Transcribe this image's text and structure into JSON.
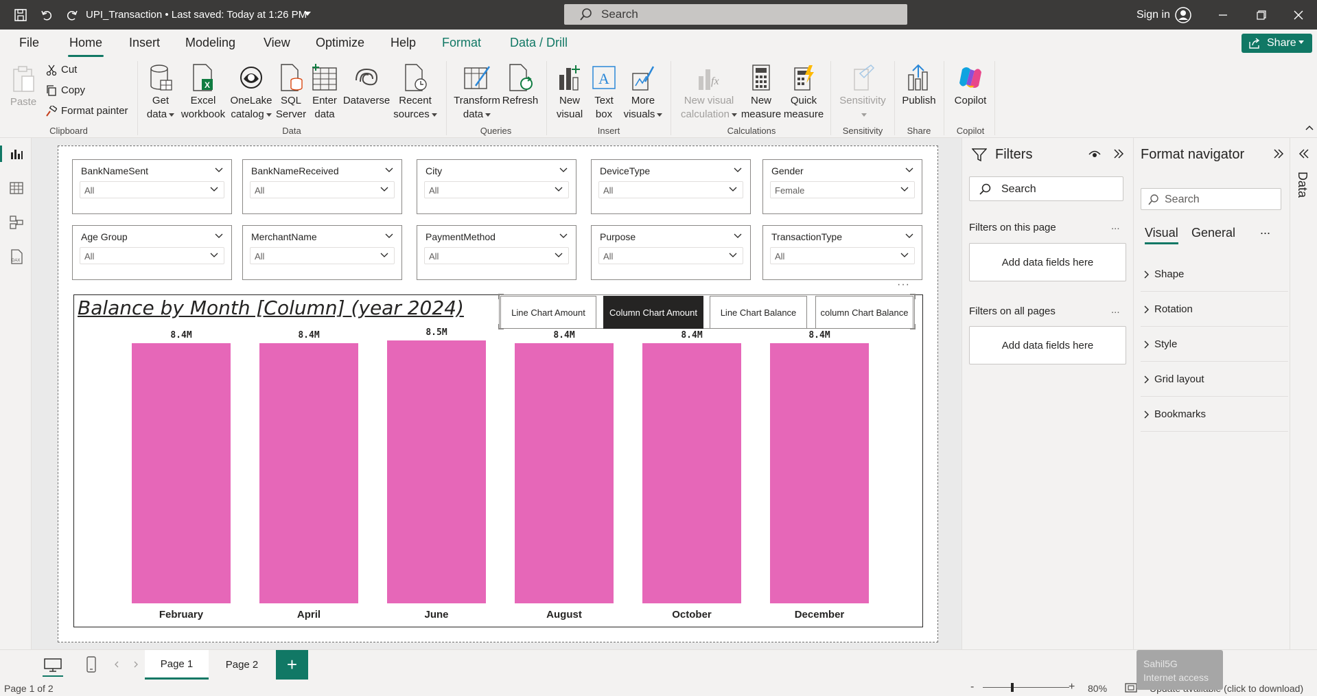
{
  "titlebar": {
    "file_title": "UPI_Transaction • Last saved: Today at 1:26 PM",
    "search_placeholder": "Search",
    "signin": "Sign in"
  },
  "menu": {
    "tabs": [
      {
        "label": "File"
      },
      {
        "label": "Home"
      },
      {
        "label": "Insert"
      },
      {
        "label": "Modeling"
      },
      {
        "label": "View"
      },
      {
        "label": "Optimize"
      },
      {
        "label": "Help"
      },
      {
        "label": "Format"
      },
      {
        "label": "Data / Drill"
      }
    ],
    "share": "Share"
  },
  "ribbon": {
    "clipboard": {
      "paste": "Paste",
      "cut": "Cut",
      "copy": "Copy",
      "format_painter": "Format painter",
      "group": "Clipboard"
    },
    "data": {
      "get_data_1": "Get",
      "get_data_2": "data",
      "excel_1": "Excel",
      "excel_2": "workbook",
      "onelake_1": "OneLake",
      "onelake_2": "catalog",
      "sql_1": "SQL",
      "sql_2": "Server",
      "enter_1": "Enter",
      "enter_2": "data",
      "dataverse": "Dataverse",
      "recent_1": "Recent",
      "recent_2": "sources",
      "group": "Data"
    },
    "queries": {
      "transform_1": "Transform",
      "transform_2": "data",
      "refresh": "Refresh",
      "group": "Queries"
    },
    "insert": {
      "new_visual_1": "New",
      "new_visual_2": "visual",
      "text_box_1": "Text",
      "text_box_2": "box",
      "more_visuals_1": "More",
      "more_visuals_2": "visuals",
      "group": "Insert"
    },
    "calculations": {
      "nvc_1": "New visual",
      "nvc_2": "calculation",
      "new_measure_1": "New",
      "new_measure_2": "measure",
      "quick_measure_1": "Quick",
      "quick_measure_2": "measure",
      "group": "Calculations"
    },
    "sensitivity": {
      "label": "Sensitivity",
      "group": "Sensitivity"
    },
    "share": {
      "publish": "Publish",
      "group": "Share"
    },
    "copilot": {
      "label": "Copilot",
      "group": "Copilot"
    }
  },
  "slicers": [
    {
      "title": "BankNameSent",
      "value": "All"
    },
    {
      "title": "BankNameReceived",
      "value": "All"
    },
    {
      "title": "City",
      "value": "All"
    },
    {
      "title": "DeviceType",
      "value": "All"
    },
    {
      "title": "Gender",
      "value": "Female"
    },
    {
      "title": "Age Group",
      "value": "All"
    },
    {
      "title": "MerchantName",
      "value": "All"
    },
    {
      "title": "PaymentMethod",
      "value": "All"
    },
    {
      "title": "Purpose",
      "value": "All"
    },
    {
      "title": "TransactionType",
      "value": "All"
    }
  ],
  "buttons": {
    "line_amount": "Line Chart Amount",
    "column_amount": "Column Chart Amount",
    "line_balance": "Line Chart Balance",
    "column_balance": "column Chart Balance"
  },
  "chart_data": {
    "type": "bar",
    "title": "Balance by Month [Column] (year 2024)",
    "categories": [
      "February",
      "April",
      "June",
      "August",
      "October",
      "December"
    ],
    "values": [
      8.4,
      8.4,
      8.5,
      8.4,
      8.4,
      8.4
    ],
    "data_labels": [
      "8.4M",
      "8.4M",
      "8.5M",
      "8.4M",
      "8.4M",
      "8.4M"
    ],
    "unit": "M",
    "bar_color": "#e667b8",
    "ylim": [
      0,
      8.5
    ]
  },
  "filters": {
    "title": "Filters",
    "search_placeholder": "Search",
    "on_page": "Filters on this page",
    "on_all": "Filters on all pages",
    "add_fields": "Add data fields here",
    "more": "..."
  },
  "format_nav": {
    "title": "Format navigator",
    "search_placeholder": "Search",
    "tabs": [
      "Visual",
      "General"
    ],
    "more": "...",
    "items": [
      "Shape",
      "Rotation",
      "Style",
      "Grid layout",
      "Bookmarks"
    ]
  },
  "data_pane": {
    "label": "Data"
  },
  "pages": {
    "tabs": [
      "Page 1",
      "Page 2"
    ],
    "add": "+"
  },
  "status": {
    "page_info": "Page 1 of 2",
    "zoom": "80%",
    "update": "Update available (click to download)",
    "minus": "-",
    "plus": "+"
  },
  "toast": {
    "line1": "Sahil5G",
    "line2": "Internet access"
  },
  "colors": {
    "accent": "#117865",
    "bar": "#e667b8",
    "titlebar": "#3b3a39"
  }
}
